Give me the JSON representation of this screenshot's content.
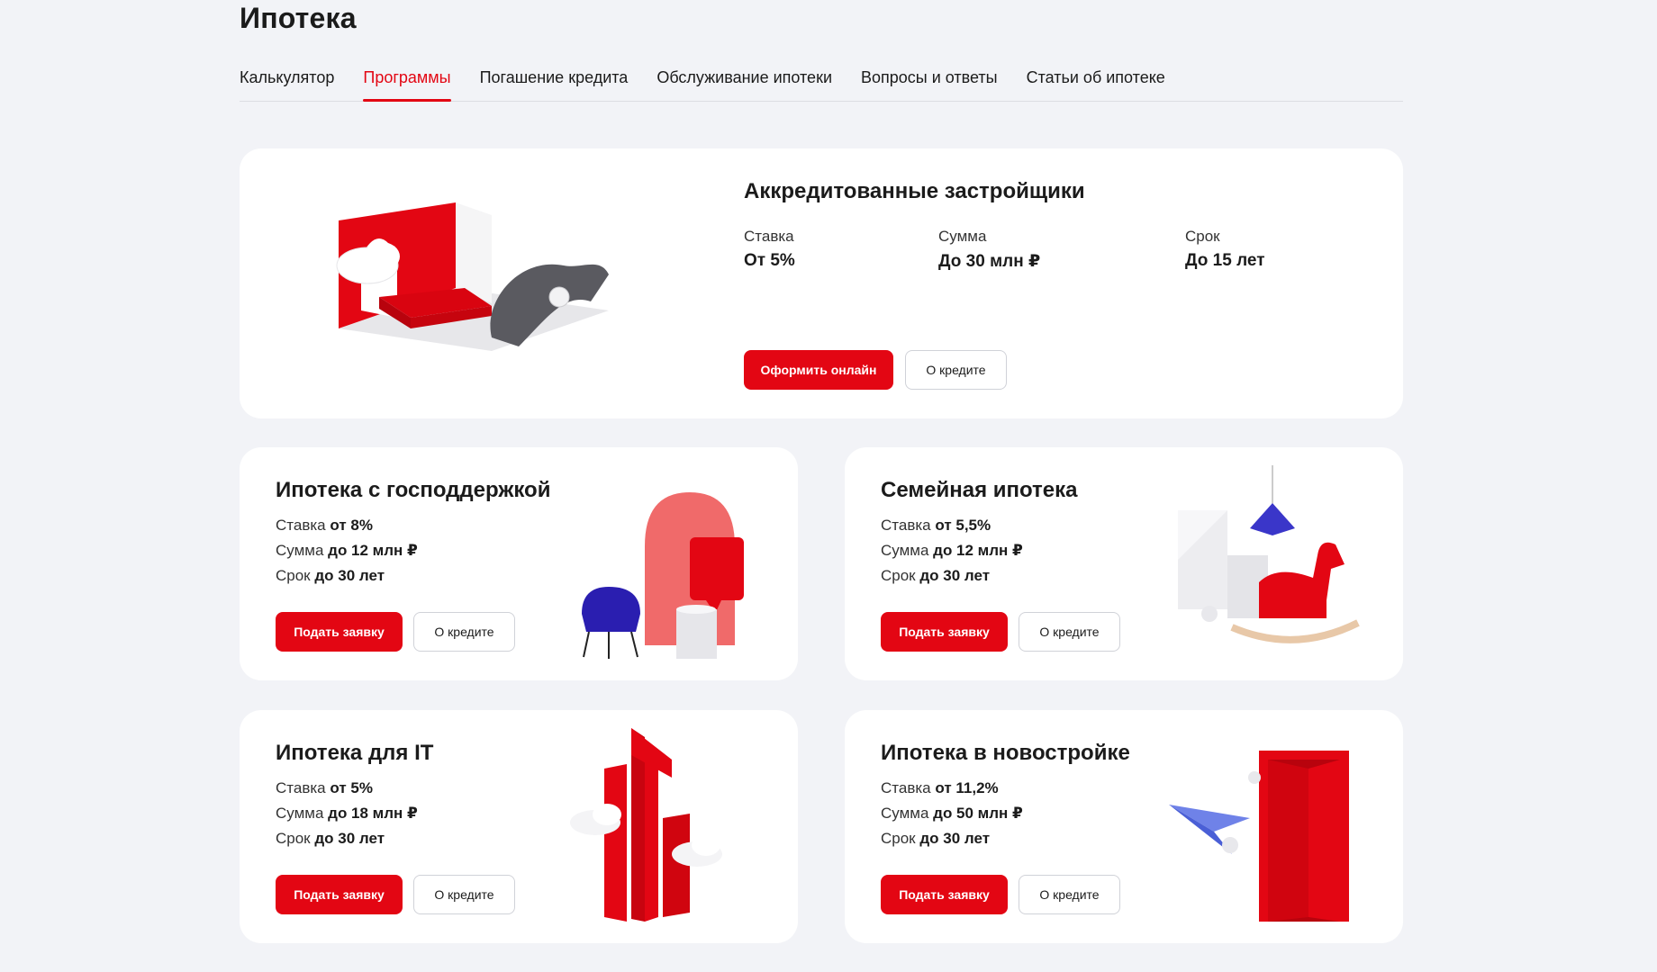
{
  "page": {
    "title": "Ипотека"
  },
  "tabs": [
    {
      "label": "Калькулятор",
      "active": false
    },
    {
      "label": "Программы",
      "active": true
    },
    {
      "label": "Погашение кредита",
      "active": false
    },
    {
      "label": "Обслуживание ипотеки",
      "active": false
    },
    {
      "label": "Вопросы и ответы",
      "active": false
    },
    {
      "label": "Статьи об ипотеке",
      "active": false
    }
  ],
  "hero": {
    "title": "Аккредитованные застройщики",
    "params": [
      {
        "label": "Ставка",
        "value": "От 5%"
      },
      {
        "label": "Сумма",
        "value": "До 30 млн ₽"
      },
      {
        "label": "Срок",
        "value": "До 15 лет"
      }
    ],
    "primary_button": "Оформить онлайн",
    "secondary_button": "О кредите",
    "illustration": "bedroom-with-cloud"
  },
  "programs": [
    {
      "title": "Ипотека с господдержкой",
      "rate_label": "Ставка",
      "rate_value": "от 8%",
      "sum_label": "Сумма",
      "sum_value": "до 12 млн ₽",
      "term_label": "Срок",
      "term_value": "до 30 лет",
      "primary_button": "Подать заявку",
      "secondary_button": "О кредите",
      "illustration": "armchair-arch"
    },
    {
      "title": "Семейная ипотека",
      "rate_label": "Ставка",
      "rate_value": "от 5,5%",
      "sum_label": "Сумма",
      "sum_value": "до 12 млн ₽",
      "term_label": "Срок",
      "term_value": "до 30 лет",
      "primary_button": "Подать заявку",
      "secondary_button": "О кредите",
      "illustration": "rocking-horse"
    },
    {
      "title": "Ипотека для IT",
      "rate_label": "Ставка",
      "rate_value": "от 5%",
      "sum_label": "Сумма",
      "sum_value": "до 18 млн ₽",
      "term_label": "Срок",
      "term_value": "до 30 лет",
      "primary_button": "Подать заявку",
      "secondary_button": "О кредите",
      "illustration": "it-letters-clouds"
    },
    {
      "title": "Ипотека в новостройке",
      "rate_label": "Ставка",
      "rate_value": "от 11,2%",
      "sum_label": "Сумма",
      "sum_value": "до 50 млн ₽",
      "term_label": "Срок",
      "term_value": "до 30 лет",
      "primary_button": "Подать заявку",
      "secondary_button": "О кредите",
      "illustration": "open-door-paper-plane"
    }
  ],
  "colors": {
    "accent": "#e30613",
    "background": "#f2f3f7",
    "card": "#ffffff",
    "text": "#1b1b1b"
  }
}
